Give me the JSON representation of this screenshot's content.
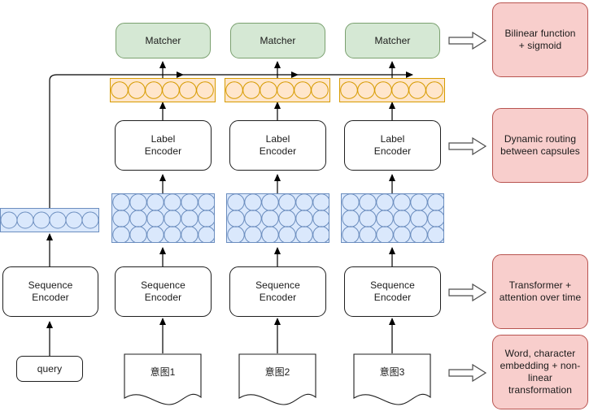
{
  "diagram": {
    "title": "Intent matching network architecture",
    "colors": {
      "matcher_fill": "#d5e8d4",
      "matcher_stroke": "#7aa06f",
      "annotation_fill": "#f8cecc",
      "annotation_stroke": "#b85450",
      "capsule_blue_fill": "#dae8fc",
      "capsule_blue_stroke": "#6c8ebf",
      "capsule_orange_fill": "#ffe6cc",
      "capsule_orange_stroke": "#d79b00",
      "box_fill": "#ffffff",
      "box_stroke": "#1f1f1f",
      "edge_color": "#000000",
      "text_color": "#1a1a1a"
    },
    "matchers": [
      {
        "label": "Matcher"
      },
      {
        "label": "Matcher"
      },
      {
        "label": "Matcher"
      }
    ],
    "label_encoders": [
      {
        "line1": "Label",
        "line2": "Encoder"
      },
      {
        "line1": "Label",
        "line2": "Encoder"
      },
      {
        "line1": "Label",
        "line2": "Encoder"
      }
    ],
    "sequence_encoders": [
      {
        "line1": "Sequence",
        "line2": "Encoder"
      },
      {
        "line1": "Sequence",
        "line2": "Encoder"
      },
      {
        "line1": "Sequence",
        "line2": "Encoder"
      },
      {
        "line1": "Sequence",
        "line2": "Encoder"
      }
    ],
    "query_box": {
      "label": "query"
    },
    "documents": [
      {
        "label": "意图1"
      },
      {
        "label": "意图2"
      },
      {
        "label": "意图3"
      }
    ],
    "capsule_layers": {
      "query_vector": {
        "rows": 1,
        "cols": 6,
        "color": "blue"
      },
      "token_capsules": {
        "rows": 3,
        "cols": 6,
        "color": "blue"
      },
      "label_capsules": {
        "rows": 1,
        "cols": 6,
        "color": "orange"
      }
    },
    "annotations": [
      {
        "line1": "Bilinear function",
        "line2": "+ sigmoid",
        "line3": ""
      },
      {
        "line1": "Dynamic routing",
        "line2": "between capsules",
        "line3": ""
      },
      {
        "line1": "Transformer +",
        "line2": "attention over time",
        "line3": ""
      },
      {
        "line1": "Word, character",
        "line2": "embedding + non-",
        "line3": "linear transformation"
      }
    ]
  }
}
